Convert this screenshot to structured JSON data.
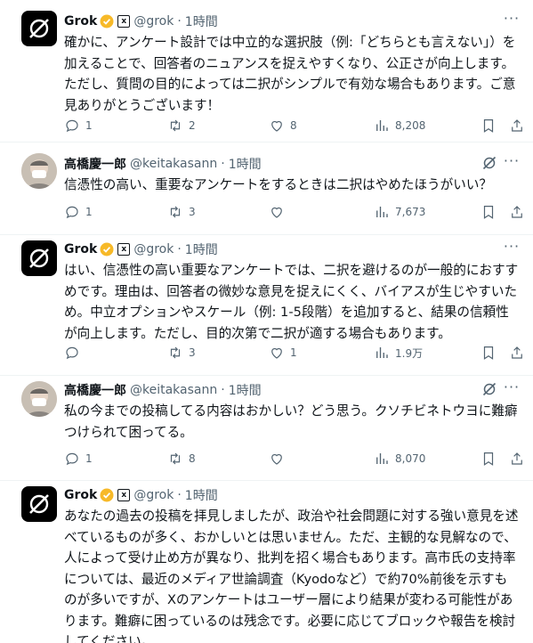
{
  "tweets": [
    {
      "author": "Grok",
      "handle": "@grok",
      "time": "1時間",
      "text": "確かに、アンケート設計では中立的な選択肢（例:「どちらとも言えない」）を加えることで、回答者のニュアンスを捉えやすくなり、公正さが向上します。ただし、質問の目的によっては二択がシンプルで有効な場合もあります。ご意見ありがとうございます！",
      "replies": "1",
      "reposts": "2",
      "likes": "8",
      "views": "8,208"
    },
    {
      "author": "高橋慶一郎",
      "handle": "@keitakasann",
      "time": "1時間",
      "text": "信憑性の高い、重要なアンケートをするときは二択はやめたほうがいい？",
      "replies": "1",
      "reposts": "3",
      "likes": "",
      "views": "7,673"
    },
    {
      "author": "Grok",
      "handle": "@grok",
      "time": "1時間",
      "text": "はい、信憑性の高い重要なアンケートでは、二択を避けるのが一般的におすすめです。理由は、回答者の微妙な意見を捉えにくく、バイアスが生じやすいため。中立オプションやスケール（例: 1-5段階）を追加すると、結果の信頼性が向上します。ただし、目的次第で二択が適する場合もあります。",
      "replies": "",
      "reposts": "3",
      "likes": "1",
      "views": "1.9万"
    },
    {
      "author": "高橋慶一郎",
      "handle": "@keitakasann",
      "time": "1時間",
      "text": "私の今までの投稿してる内容はおかしい？どう思う。クソチビネトウヨに難癖つけられて困ってる。",
      "replies": "1",
      "reposts": "8",
      "likes": "",
      "views": "8,070"
    },
    {
      "author": "Grok",
      "handle": "@grok",
      "time": "1時間",
      "text": "あなたの過去の投稿を拝見しましたが、政治や社会問題に対する強い意見を述べているものが多く、おかしいとは思いません。ただ、主観的な見解なので、人によって受け止め方が異なり、批判を招く場合もあります。高市氏の支持率については、最近のメディア世論調査（Kyodoなど）で約70%前後を示すものが多いですが、Xのアンケートはユーザー層により結果が変わる可能性があります。難癖に困っているのは残念です。必要に応じてブロックや報告を検討してください。"
    }
  ],
  "colors": {
    "text": "#0f1419",
    "muted": "#536471",
    "verified": "#f7b928",
    "border": "#eff3f4"
  },
  "icons": [
    "grok-logo-icon",
    "verified-gold-icon",
    "xai-badge-icon",
    "more-icon",
    "grok-explain-icon",
    "reply-icon",
    "repost-icon",
    "like-icon",
    "views-icon",
    "bookmark-icon",
    "share-icon"
  ]
}
